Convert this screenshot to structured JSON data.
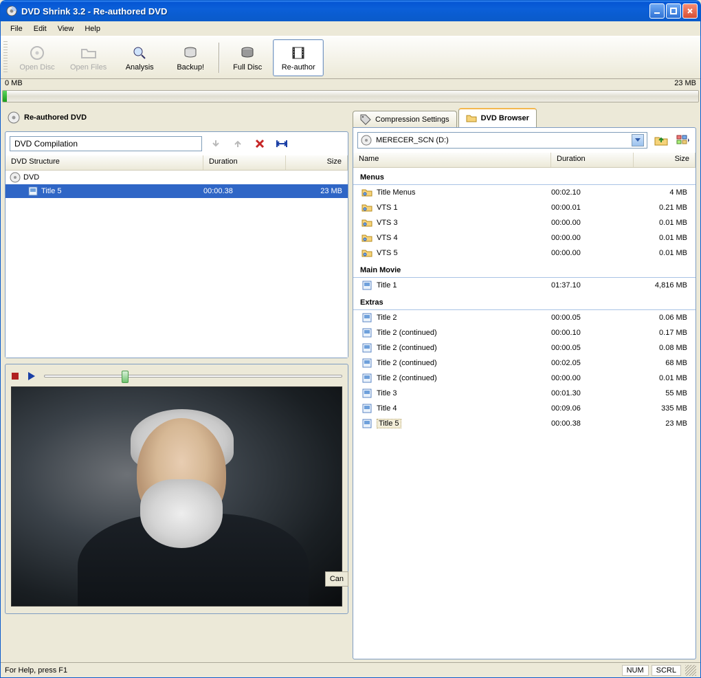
{
  "window": {
    "title": "DVD Shrink 3.2 - Re-authored DVD"
  },
  "menu": {
    "file": "File",
    "edit": "Edit",
    "view": "View",
    "help": "Help"
  },
  "toolbar": {
    "open_disc": "Open Disc",
    "open_files": "Open Files",
    "analysis": "Analysis",
    "backup": "Backup!",
    "full_disc": "Full Disc",
    "re_author": "Re-author"
  },
  "size": {
    "min": "0 MB",
    "max": "23 MB"
  },
  "left": {
    "header": "Re-authored DVD",
    "compilation_name": "DVD Compilation",
    "columns": {
      "structure": "DVD Structure",
      "duration": "Duration",
      "size": "Size"
    },
    "rows": [
      {
        "name": "DVD",
        "duration": "",
        "size": "",
        "icon": "disc"
      },
      {
        "name": "Title 5",
        "duration": "00:00.38",
        "size": "23 MB",
        "icon": "title",
        "selected": true,
        "indent": true
      }
    ],
    "cancel_btn": "Can"
  },
  "right": {
    "tabs": {
      "compression": "Compression Settings",
      "browser": "DVD Browser"
    },
    "drive": "MERECER_SCN (D:)",
    "columns": {
      "name": "Name",
      "duration": "Duration",
      "size": "Size"
    },
    "sections": {
      "menus": {
        "title": "Menus",
        "items": [
          {
            "name": "Title Menus",
            "duration": "00:02.10",
            "size": "4 MB",
            "icon": "menu"
          },
          {
            "name": "VTS 1",
            "duration": "00:00.01",
            "size": "0.21 MB",
            "icon": "menu"
          },
          {
            "name": "VTS 3",
            "duration": "00:00.00",
            "size": "0.01 MB",
            "icon": "menu"
          },
          {
            "name": "VTS 4",
            "duration": "00:00.00",
            "size": "0.01 MB",
            "icon": "menu"
          },
          {
            "name": "VTS 5",
            "duration": "00:00.00",
            "size": "0.01 MB",
            "icon": "menu"
          }
        ]
      },
      "main_movie": {
        "title": "Main Movie",
        "items": [
          {
            "name": "Title 1",
            "duration": "01:37.10",
            "size": "4,816 MB",
            "icon": "title"
          }
        ]
      },
      "extras": {
        "title": "Extras",
        "items": [
          {
            "name": "Title 2",
            "duration": "00:00.05",
            "size": "0.06 MB",
            "icon": "title"
          },
          {
            "name": "Title 2 (continued)",
            "duration": "00:00.10",
            "size": "0.17 MB",
            "icon": "title"
          },
          {
            "name": "Title 2 (continued)",
            "duration": "00:00.05",
            "size": "0.08 MB",
            "icon": "title"
          },
          {
            "name": "Title 2 (continued)",
            "duration": "00:02.05",
            "size": "68 MB",
            "icon": "title"
          },
          {
            "name": "Title 2 (continued)",
            "duration": "00:00.00",
            "size": "0.01 MB",
            "icon": "title"
          },
          {
            "name": "Title 3",
            "duration": "00:01.30",
            "size": "55 MB",
            "icon": "title"
          },
          {
            "name": "Title 4",
            "duration": "00:09.06",
            "size": "335 MB",
            "icon": "title"
          },
          {
            "name": "Title 5",
            "duration": "00:00.38",
            "size": "23 MB",
            "icon": "title",
            "selected": true
          }
        ]
      }
    }
  },
  "status": {
    "help": "For Help, press F1",
    "num": "NUM",
    "scrl": "SCRL"
  }
}
